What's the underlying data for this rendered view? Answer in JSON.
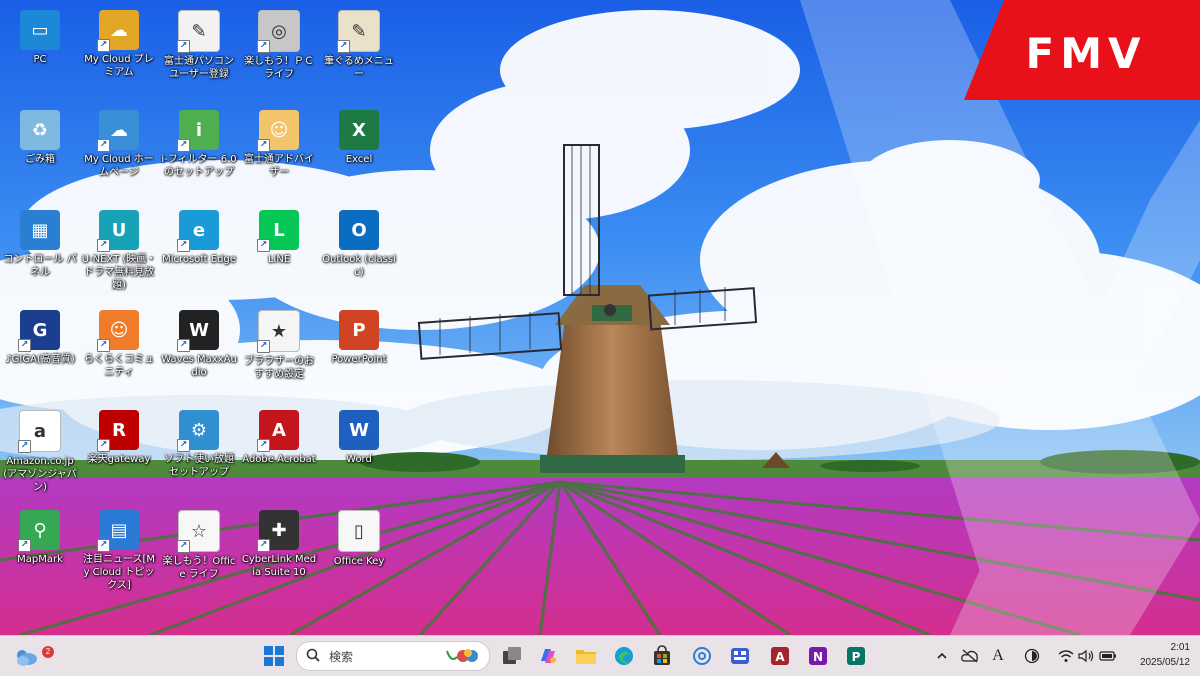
{
  "fmv": {
    "text": "FMV",
    "color": "#e8111a"
  },
  "desktop_icons": [
    {
      "label": "PC",
      "icon": "pc-icon",
      "color": "#1e88d8",
      "glyph": "▭",
      "shortcut": false
    },
    {
      "label": "My Cloud プレミアム",
      "icon": "my-cloud-premium-icon",
      "color": "#e2a525",
      "glyph": "☁",
      "shortcut": true
    },
    {
      "label": "富士通パソコンユーザー登録",
      "icon": "fujitsu-registration-icon",
      "color": "#f2f2f2",
      "glyph": "✎",
      "shortcut": true
    },
    {
      "label": "楽しもう！ＰＣライフ",
      "icon": "pc-life-icon",
      "color": "#c7c7c7",
      "glyph": "◎",
      "shortcut": true
    },
    {
      "label": "筆ぐるめメニュー",
      "icon": "fudegurume-icon",
      "color": "#e9e1c8",
      "glyph": "✎",
      "shortcut": true
    },
    {
      "label": "ごみ箱",
      "icon": "recycle-bin-icon",
      "color": "#7fb9e0",
      "glyph": "♻",
      "shortcut": false
    },
    {
      "label": "My Cloud ホームページ",
      "icon": "my-cloud-home-icon",
      "color": "#3a8fd8",
      "glyph": "☁",
      "shortcut": true
    },
    {
      "label": "i-フィルター 6.0のセットアップ",
      "icon": "i-filter-icon",
      "color": "#4fae4f",
      "glyph": "i",
      "shortcut": true
    },
    {
      "label": "富士通アドバイザー",
      "icon": "fujitsu-advisor-icon",
      "color": "#f3c46a",
      "glyph": "☺",
      "shortcut": true
    },
    {
      "label": "Excel",
      "icon": "excel-icon",
      "color": "#1d7a44",
      "glyph": "X",
      "shortcut": false
    },
    {
      "label": "コントロール パネル",
      "icon": "control-panel-icon",
      "color": "#2a7fd2",
      "glyph": "▦",
      "shortcut": false
    },
    {
      "label": "U-NEXT (映画・ドラマ無料見放題)",
      "icon": "u-next-icon",
      "color": "#17a2b8",
      "glyph": "U",
      "shortcut": true
    },
    {
      "label": "Microsoft Edge",
      "icon": "edge-icon",
      "color": "#1a9ad6",
      "glyph": "e",
      "shortcut": true
    },
    {
      "label": "LINE",
      "icon": "line-icon",
      "color": "#06c755",
      "glyph": "L",
      "shortcut": true
    },
    {
      "label": "Outlook (classic)",
      "icon": "outlook-icon",
      "color": "#0a6dc2",
      "glyph": "O",
      "shortcut": false
    },
    {
      "label": "♪GIGA(高音質)",
      "icon": "giga-icon",
      "color": "#1c3e8f",
      "glyph": "G",
      "shortcut": true
    },
    {
      "label": "らくらくコミュニティ",
      "icon": "raku-community-icon",
      "color": "#f07c2a",
      "glyph": "☺",
      "shortcut": true
    },
    {
      "label": "Waves MaxxAudio",
      "icon": "waves-icon",
      "color": "#222222",
      "glyph": "W",
      "shortcut": true
    },
    {
      "label": "ブラウザーのおすすめ設定",
      "icon": "browser-settings-icon",
      "color": "#f5f5f5",
      "glyph": "★",
      "shortcut": true
    },
    {
      "label": "PowerPoint",
      "icon": "powerpoint-icon",
      "color": "#d04423",
      "glyph": "P",
      "shortcut": false
    },
    {
      "label": "Amazon.co.jp(アマゾンジャパン)",
      "icon": "amazon-icon",
      "color": "#ffffff",
      "glyph": "a",
      "shortcut": true
    },
    {
      "label": "楽天gateway",
      "icon": "rakuten-icon",
      "color": "#bf0000",
      "glyph": "R",
      "shortcut": true
    },
    {
      "label": "ソフト使い放題セットアップ",
      "icon": "soft-setup-icon",
      "color": "#2f8fd0",
      "glyph": "⚙",
      "shortcut": true
    },
    {
      "label": "Adobe Acrobat",
      "icon": "acrobat-icon",
      "color": "#c4151c",
      "glyph": "A",
      "shortcut": true
    },
    {
      "label": "Word",
      "icon": "word-icon",
      "color": "#1f5fbf",
      "glyph": "W",
      "shortcut": false
    },
    {
      "label": "MapMark",
      "icon": "mapmark-icon",
      "color": "#36a853",
      "glyph": "⚲",
      "shortcut": true
    },
    {
      "label": "注目ニュース[My Cloud トピックス]",
      "icon": "news-icon",
      "color": "#2b7bd6",
      "glyph": "▤",
      "shortcut": true
    },
    {
      "label": "楽しもう！Office ライフ",
      "icon": "office-life-icon",
      "color": "#f7f7f7",
      "glyph": "☆",
      "shortcut": true
    },
    {
      "label": "CyberLink Media Suite 10",
      "icon": "cyberlink-icon",
      "color": "#333333",
      "glyph": "✚",
      "shortcut": true
    },
    {
      "label": "Office Key",
      "icon": "office-key-file-icon",
      "color": "#f7f7f7",
      "glyph": "▯",
      "shortcut": false
    }
  ],
  "taskbar": {
    "widgets_badge": "2",
    "search_placeholder": "検索",
    "apps": [
      {
        "name": "start-button",
        "icon": "windows-start-icon"
      },
      {
        "name": "task-view-button",
        "icon": "task-view-icon"
      },
      {
        "name": "copilot-button",
        "icon": "copilot-icon"
      },
      {
        "name": "file-explorer-button",
        "icon": "folder-icon"
      },
      {
        "name": "edge-taskbar-button",
        "icon": "edge-icon"
      },
      {
        "name": "store-button",
        "icon": "store-icon"
      },
      {
        "name": "mail-button",
        "icon": "mail-icon"
      },
      {
        "name": "phone-link-button",
        "icon": "phone-link-icon"
      },
      {
        "name": "access-button",
        "icon": "access-icon"
      },
      {
        "name": "onenote-button",
        "icon": "onenote-icon"
      },
      {
        "name": "publisher-button",
        "icon": "publisher-icon"
      }
    ],
    "tray": {
      "ime": "A",
      "time": "2:01",
      "date": "2025/05/12"
    }
  }
}
